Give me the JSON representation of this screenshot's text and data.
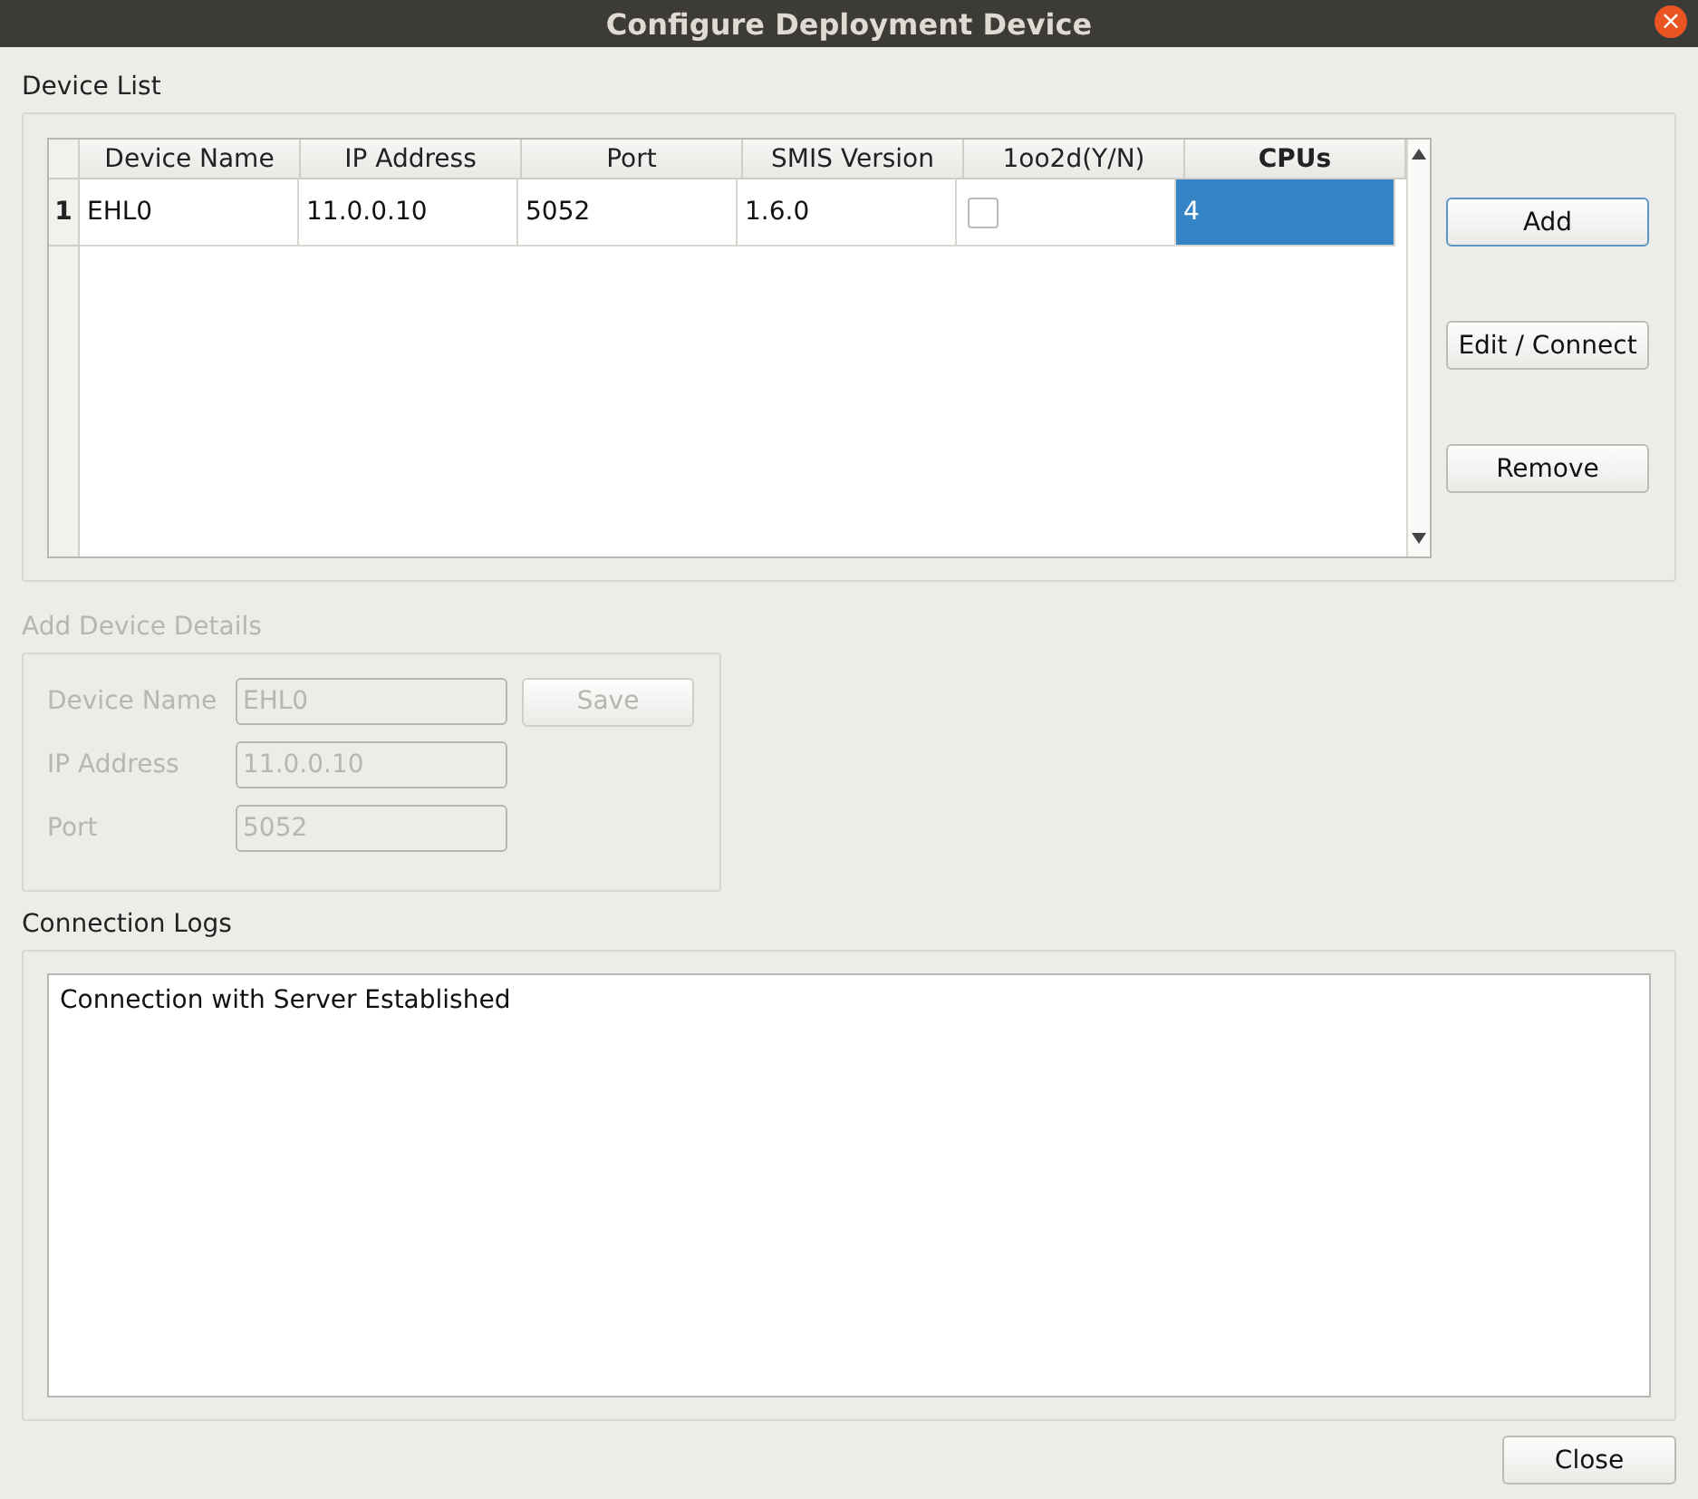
{
  "window": {
    "title": "Configure Deployment Device",
    "close_glyph": "×"
  },
  "device_list": {
    "title": "Device List",
    "columns": [
      {
        "label": "Device Name",
        "selected": false
      },
      {
        "label": "IP Address",
        "selected": false
      },
      {
        "label": "Port",
        "selected": false
      },
      {
        "label": "SMIS Version",
        "selected": false
      },
      {
        "label": "1oo2d(Y/N)",
        "selected": false
      },
      {
        "label": "CPUs",
        "selected": true
      }
    ],
    "rows": [
      {
        "header": "1",
        "cells": [
          {
            "kind": "text",
            "value": "EHL0",
            "selected": false
          },
          {
            "kind": "text",
            "value": "11.0.0.10",
            "selected": false
          },
          {
            "kind": "text",
            "value": "5052",
            "selected": false
          },
          {
            "kind": "text",
            "value": "1.6.0",
            "selected": false
          },
          {
            "kind": "checkbox",
            "checked": false,
            "selected": false
          },
          {
            "kind": "text",
            "value": "4",
            "selected": true
          }
        ]
      }
    ],
    "buttons": [
      {
        "label": "Add",
        "default": true
      },
      {
        "label": "Edit / Connect",
        "default": false
      },
      {
        "label": "Remove",
        "default": false
      }
    ]
  },
  "device_details": {
    "title": "Add Device Details",
    "disabled": true,
    "fields": [
      {
        "label": "Device Name",
        "value": "EHL0"
      },
      {
        "label": "IP Address",
        "value": "11.0.0.10"
      },
      {
        "label": "Port",
        "value": "5052"
      }
    ],
    "save_button": "Save"
  },
  "connection_logs": {
    "title": "Connection Logs",
    "lines": [
      "Connection with Server Established"
    ]
  },
  "close_button": "Close"
}
